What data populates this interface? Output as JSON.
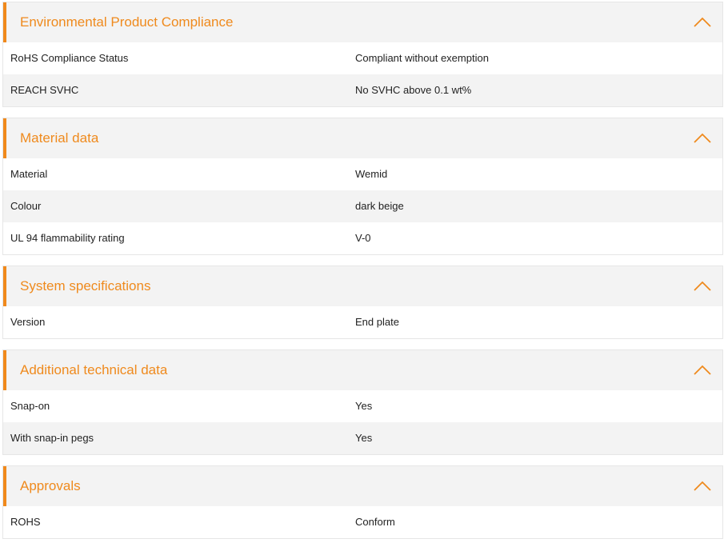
{
  "accent_color": "#f0891c",
  "sections": [
    {
      "title": "Environmental Product Compliance",
      "toggle_icon": "chevron-up-icon",
      "rows": [
        {
          "label": "RoHS Compliance Status",
          "value": "Compliant without exemption"
        },
        {
          "label": "REACH SVHC",
          "value": "No SVHC above 0.1 wt%"
        }
      ]
    },
    {
      "title": "Material data",
      "toggle_icon": "chevron-up-icon",
      "rows": [
        {
          "label": "Material",
          "value": "Wemid"
        },
        {
          "label": "Colour",
          "value": "dark beige"
        },
        {
          "label": "UL 94 flammability rating",
          "value": "V-0"
        }
      ]
    },
    {
      "title": "System specifications",
      "toggle_icon": "chevron-up-icon",
      "rows": [
        {
          "label": "Version",
          "value": "End plate"
        }
      ]
    },
    {
      "title": "Additional technical data",
      "toggle_icon": "chevron-up-icon",
      "rows": [
        {
          "label": "Snap-on",
          "value": "Yes"
        },
        {
          "label": "With snap-in pegs",
          "value": "Yes"
        }
      ]
    },
    {
      "title": "Approvals",
      "toggle_icon": "chevron-up-icon",
      "rows": [
        {
          "label": "ROHS",
          "value": "Conform"
        }
      ]
    }
  ]
}
